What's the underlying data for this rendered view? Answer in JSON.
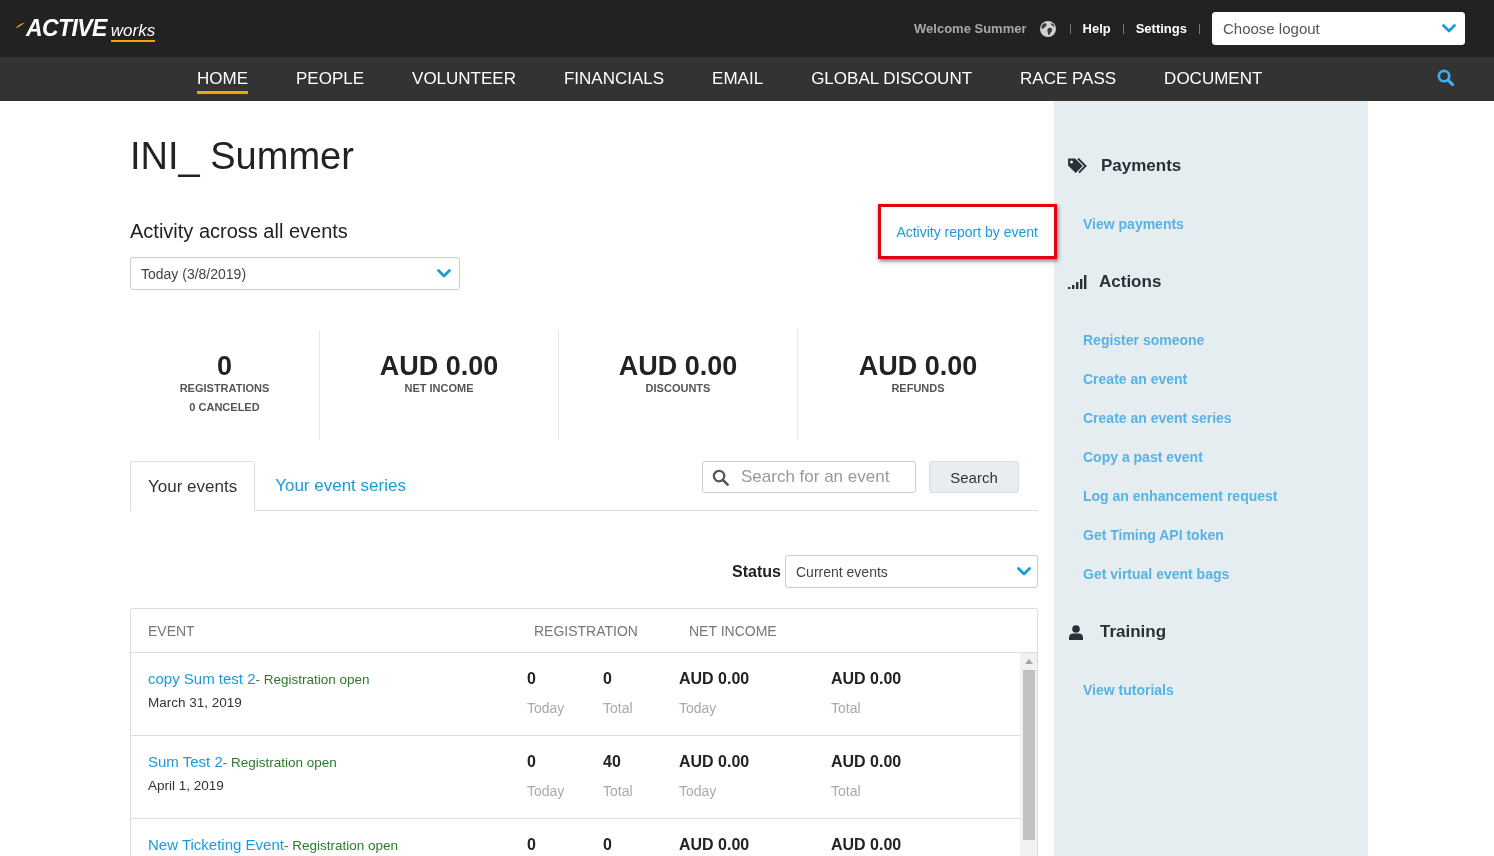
{
  "header": {
    "logo": {
      "wordmark": "ACTIVE",
      "suffix": "works"
    },
    "welcome": "Welcome Summer",
    "links": [
      "Help",
      "Settings"
    ],
    "logout_select": {
      "value": "Choose logout"
    }
  },
  "nav": {
    "items": [
      {
        "label": "HOME",
        "selected": true
      },
      {
        "label": "PEOPLE",
        "selected": false
      },
      {
        "label": "VOLUNTEER",
        "selected": false
      },
      {
        "label": "FINANCIALS",
        "selected": false
      },
      {
        "label": "EMAIL",
        "selected": false
      },
      {
        "label": "GLOBAL DISCOUNT",
        "selected": false
      },
      {
        "label": "RACE PASS",
        "selected": false
      },
      {
        "label": "DOCUMENT",
        "selected": false
      }
    ]
  },
  "page": {
    "title": "INI_ Summer",
    "activity_heading": "Activity across all events",
    "report_link": {
      "label": "Activity report by event",
      "highlighted": true
    },
    "period_select": {
      "value": "Today (3/8/2019)"
    }
  },
  "stats": [
    {
      "value": "0",
      "label": "REGISTRATIONS",
      "sublabel": "0 CANCELED"
    },
    {
      "value": "AUD 0.00",
      "label": "NET INCOME"
    },
    {
      "value": "AUD 0.00",
      "label": "DISCOUNTS"
    },
    {
      "value": "AUD 0.00",
      "label": "REFUNDS"
    }
  ],
  "tabs": [
    {
      "label": "Your events",
      "selected": true
    },
    {
      "label": "Your event series",
      "selected": false
    }
  ],
  "search": {
    "placeholder": "Search for an event",
    "button": "Search"
  },
  "status_filter": {
    "label": "Status",
    "value": "Current events"
  },
  "table": {
    "columns": [
      "EVENT",
      "REGISTRATION",
      "NET INCOME"
    ],
    "rows": [
      {
        "name": "copy Sum test 2",
        "status": "- Registration open",
        "date": "March 31, 2019",
        "cells": [
          {
            "value": "0",
            "caption": "Today"
          },
          {
            "value": "0",
            "caption": "Total"
          },
          {
            "value": "AUD 0.00",
            "caption": "Today"
          },
          {
            "value": "AUD 0.00",
            "caption": "Total"
          }
        ]
      },
      {
        "name": "Sum Test 2",
        "status": "- Registration open",
        "date": "April 1, 2019",
        "cells": [
          {
            "value": "0",
            "caption": "Today"
          },
          {
            "value": "40",
            "caption": "Total"
          },
          {
            "value": "AUD 0.00",
            "caption": "Today"
          },
          {
            "value": "AUD 0.00",
            "caption": "Total"
          }
        ]
      },
      {
        "name": "New Ticketing Event",
        "status": "- Registration open",
        "cells": [
          {
            "value": "0"
          },
          {
            "value": "0"
          },
          {
            "value": "AUD 0.00"
          },
          {
            "value": "AUD 0.00"
          }
        ]
      }
    ]
  },
  "sidebar": {
    "sections": [
      {
        "title": "Payments",
        "links": [
          "View payments"
        ]
      },
      {
        "title": "Actions",
        "links": [
          "Register someone",
          "Create an event",
          "Create an event series",
          "Copy a past event",
          "Log an enhancement request",
          "Get Timing API token",
          "Get virtual event bags"
        ]
      },
      {
        "title": "Training",
        "links": [
          "View tutorials"
        ]
      }
    ]
  }
}
